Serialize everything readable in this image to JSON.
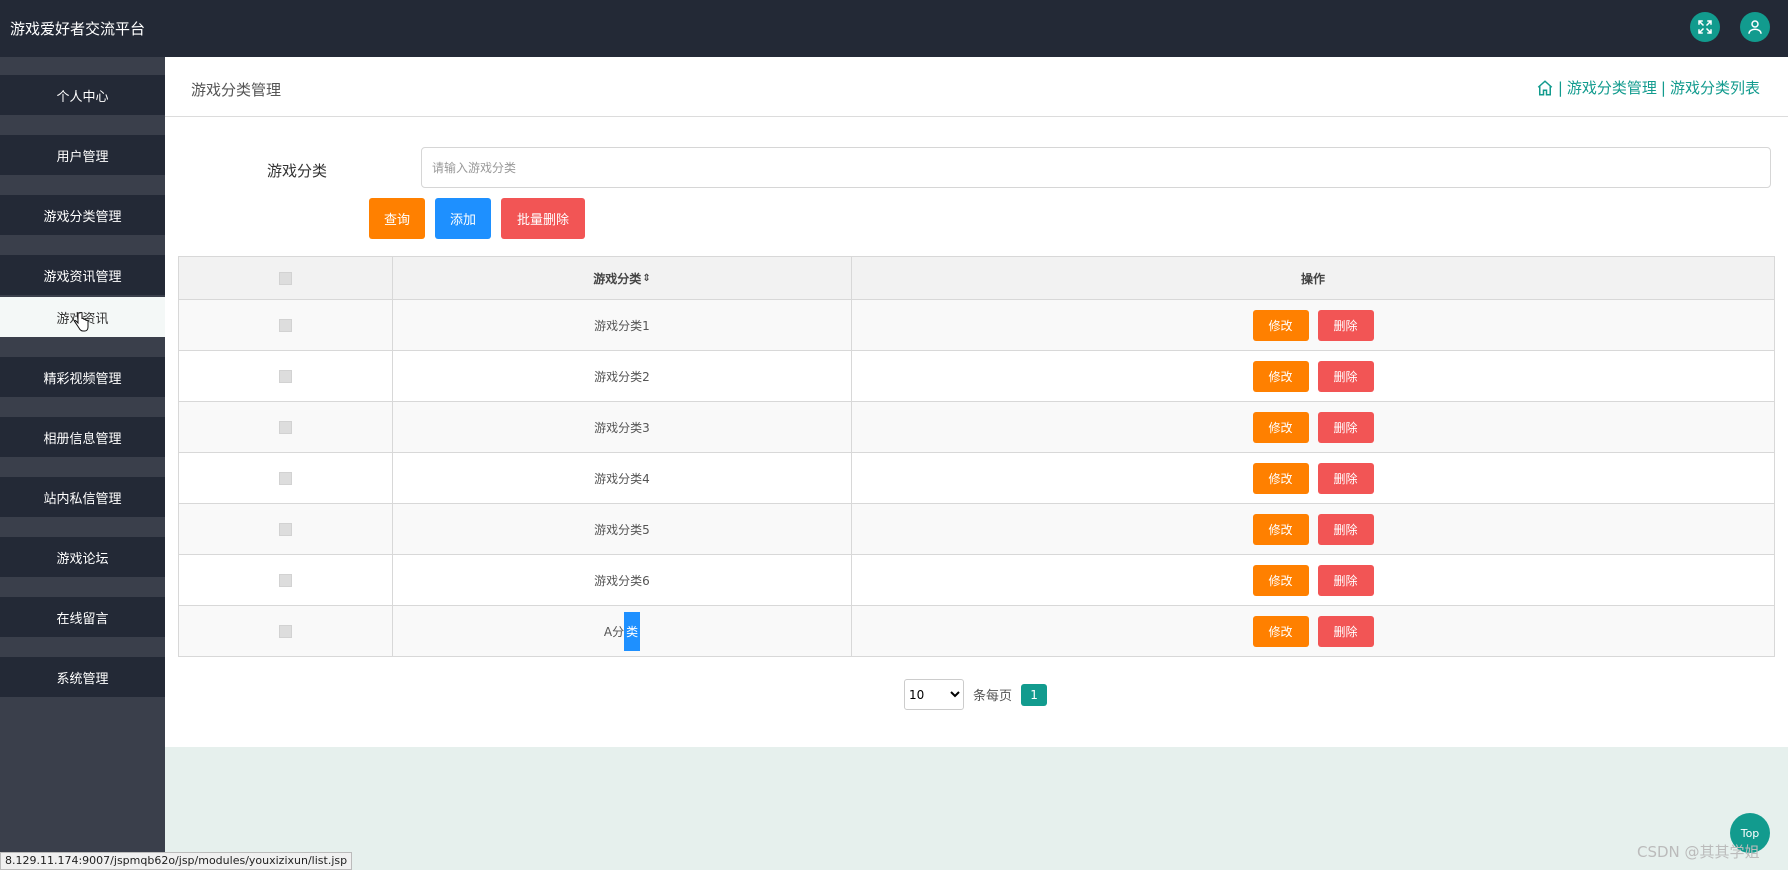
{
  "app": {
    "title": "游戏爱好者交流平台"
  },
  "header": {
    "icons": [
      "fullscreen-icon",
      "user-icon"
    ]
  },
  "sidebar": {
    "items": [
      {
        "label": "个人中心"
      },
      {
        "label": "用户管理"
      },
      {
        "label": "游戏分类管理"
      },
      {
        "label": "游戏资讯管理",
        "sub": "游戏资讯"
      },
      {
        "label": "精彩视频管理"
      },
      {
        "label": "相册信息管理"
      },
      {
        "label": "站内私信管理"
      },
      {
        "label": "游戏论坛"
      },
      {
        "label": "在线留言"
      },
      {
        "label": "系统管理"
      }
    ]
  },
  "page": {
    "title": "游戏分类管理",
    "breadcrumb": [
      "游戏分类管理",
      "游戏分类列表"
    ]
  },
  "search": {
    "label": "游戏分类",
    "placeholder": "请输入游戏分类",
    "value": ""
  },
  "toolbar": {
    "query": "查询",
    "add": "添加",
    "batch_delete": "批量删除"
  },
  "table": {
    "headers": {
      "name": "游戏分类",
      "actions": "操作"
    },
    "rows": [
      {
        "name": "游戏分类1"
      },
      {
        "name": "游戏分类2"
      },
      {
        "name": "游戏分类3"
      },
      {
        "name": "游戏分类4"
      },
      {
        "name": "游戏分类5"
      },
      {
        "name": "游戏分类6"
      },
      {
        "name_a": "A分",
        "name_b": "类"
      }
    ],
    "edit_label": "修改",
    "delete_label": "删除"
  },
  "pagination": {
    "page_size": "10",
    "per_page_label": "条每页",
    "current": "1"
  },
  "status_url": "8.129.11.174:9007/jspmqb62o/jsp/modules/youxizixun/list.jsp",
  "top_button": "Top",
  "watermark": "CSDN @其其学姐",
  "colors": {
    "accent": "#129b8e",
    "sidebar": "#232936",
    "orange": "#ff8000",
    "blue": "#1e90ff",
    "red": "#f25555"
  }
}
